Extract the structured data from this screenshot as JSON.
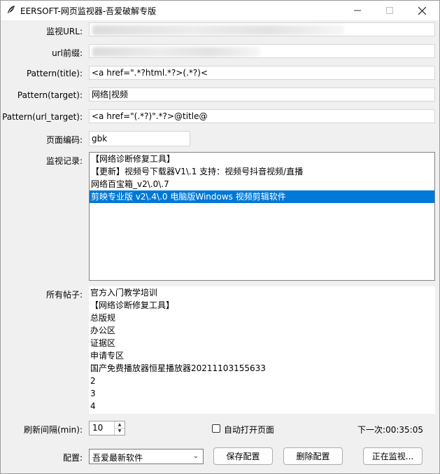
{
  "window": {
    "title": "EERSOFT-网页监视器-吾爱破解专版",
    "icon": "feather-icon",
    "controls": [
      "minimize-icon",
      "maximize-icon",
      "close-icon"
    ]
  },
  "form": {
    "monitor_url_label": "监视URL:",
    "url_prefix_label": "url前缀:",
    "pattern_title_label": "Pattern(title):",
    "pattern_title_value": "<a href=\".*?html.*?>(.*?)<",
    "pattern_target_label": "Pattern(target):",
    "pattern_target_value": "网络|视频",
    "pattern_url_target_label": "Pattern(url_target):",
    "pattern_url_target_value": "<a href=\"(.*?)\".*?>@title@",
    "encoding_label": "页面编码:",
    "encoding_value": "gbk"
  },
  "monitor_log": {
    "label": "监视记录:",
    "items": [
      "【网络诊断修复工具】",
      "【更新】视频号下载器V1\\.1 支持：视频号抖音视频/直播",
      "网络百宝箱_v2\\.0\\.7",
      "剪映专业版 v2\\.4\\.0 电脑版Windows  视频剪辑软件"
    ],
    "selected_index": 3
  },
  "all_posts": {
    "label": "所有帖子:",
    "items": [
      "官方入门教学培训",
      "【网络诊断修复工具】",
      "总版规",
      "办公区",
      "证据区",
      "申请专区",
      "国产免费播放器恒星播放器20211103155633",
      "2",
      "3",
      "4"
    ]
  },
  "bottom": {
    "refresh_label": "刷新间隔(min):",
    "refresh_value": "10",
    "auto_open_label": "自动打开页面",
    "auto_open_checked": false,
    "next_time": "下一次:00:35:05",
    "config_label": "配置:",
    "config_value": "吾爱最新软件",
    "save_button": "保存配置",
    "delete_button": "删除配置",
    "monitoring_button": "正在监视..."
  },
  "colors": {
    "selection": "#0078d7",
    "window_bg": "#f0f0f0"
  }
}
